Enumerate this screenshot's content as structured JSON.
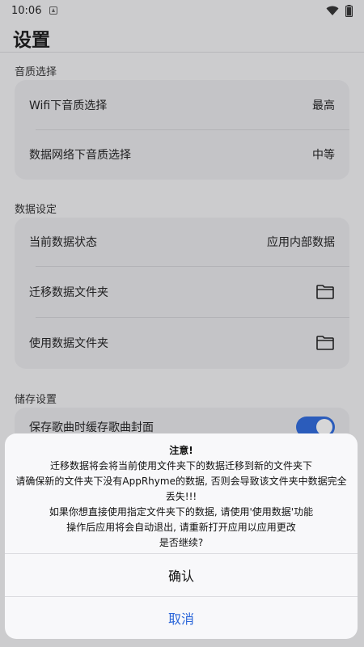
{
  "status_bar": {
    "time": "10:06",
    "icons": [
      "notification-icon",
      "wifi-icon",
      "battery-icon"
    ]
  },
  "header": {
    "title": "设置"
  },
  "sections": {
    "quality": {
      "label": "音质选择",
      "rows": [
        {
          "label": "Wifi下音质选择",
          "value": "最高"
        },
        {
          "label": "数据网络下音质选择",
          "value": "中等"
        }
      ]
    },
    "data": {
      "label": "数据设定",
      "rows": [
        {
          "label": "当前数据状态",
          "value": "应用内部数据"
        },
        {
          "label": "迁移数据文件夹",
          "icon": "folder-icon"
        },
        {
          "label": "使用数据文件夹",
          "icon": "folder-icon"
        }
      ]
    },
    "storage": {
      "label": "储存设置",
      "rows": [
        {
          "label": "保存歌曲时缓存歌曲封面",
          "toggle": true
        }
      ]
    }
  },
  "dialog": {
    "lines": [
      "注意!",
      "迁移数据将会将当前使用文件夹下的数据迁移到新的文件夹下",
      "请确保新的文件夹下没有AppRhyme的数据, 否则会导致该文件夹中数据完全丢失!!!",
      "如果你想直接使用指定文件夹下的数据, 请使用'使用数据'功能",
      "操作后应用将会自动退出, 请重新打开应用以应用更改",
      "是否继续?"
    ],
    "confirm_label": "确认",
    "cancel_label": "取消"
  },
  "colors": {
    "accent": "#2f6bdd",
    "cancel_text": "#2b66d9",
    "card": "#e9e9ec",
    "background": "#f3f3f5"
  }
}
